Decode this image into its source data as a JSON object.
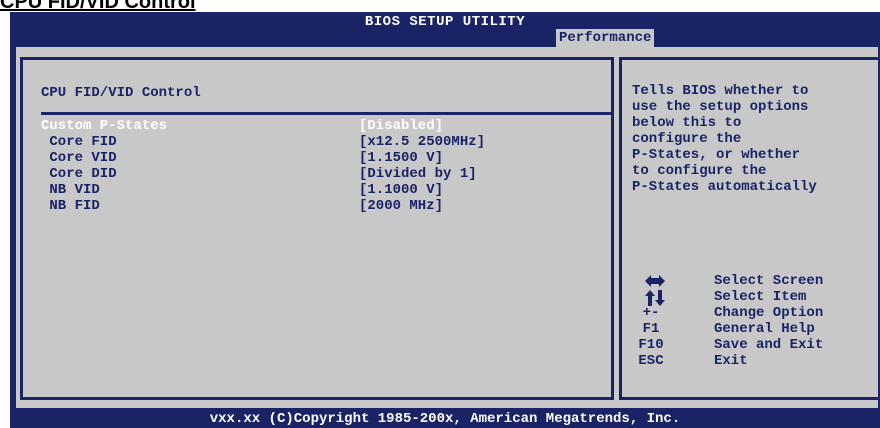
{
  "page_caption": "CPU FID/VID Control",
  "header": {
    "title": "BIOS SETUP UTILITY",
    "active_tab": "Performance"
  },
  "section_title": "CPU FID/VID Control",
  "items": [
    {
      "label": "Custom P-States",
      "value": "[Disabled]",
      "selected": true
    },
    {
      "label": " Core FID",
      "value": "[x12.5 2500MHz]",
      "selected": false
    },
    {
      "label": " Core VID",
      "value": "[1.1500 V]",
      "selected": false
    },
    {
      "label": " Core DID",
      "value": "[Divided by 1]",
      "selected": false
    },
    {
      "label": " NB VID",
      "value": "[1.1000 V]",
      "selected": false
    },
    {
      "label": " NB FID",
      "value": "[2000 MHz]",
      "selected": false
    }
  ],
  "help_lines": [
    "Tells BIOS whether to",
    "use the setup options",
    "below this to",
    "configure the",
    "P-States, or whether",
    "to configure the",
    "P-States automatically"
  ],
  "keys": [
    {
      "key": "",
      "icon": "left-right-arrows-icon",
      "desc": "Select Screen"
    },
    {
      "key": "",
      "icon": "up-down-arrows-icon",
      "desc": "Select Item"
    },
    {
      "key": "+-",
      "desc": "Change Option"
    },
    {
      "key": "F1",
      "desc": "General Help"
    },
    {
      "key": "F10",
      "desc": "Save and Exit"
    },
    {
      "key": "ESC",
      "desc": "Exit"
    }
  ],
  "footer": "vxx.xx (C)Copyright 1985-200x, American Megatrends, Inc.",
  "colors": {
    "background": "#1a2366",
    "panel": "#c8c8c8",
    "selected_text": "#ffffff"
  }
}
